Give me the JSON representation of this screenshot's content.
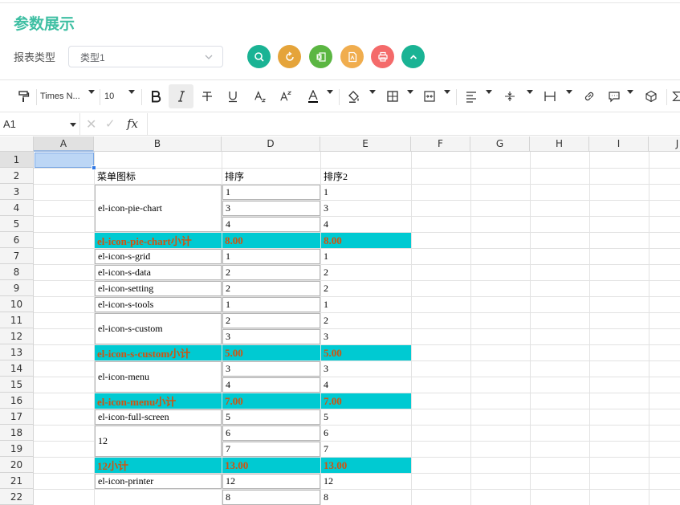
{
  "page": {
    "title": "参数展示"
  },
  "filter": {
    "label": "报表类型",
    "value": "类型1"
  },
  "actions": [
    {
      "name": "search",
      "color": "#1ab394"
    },
    {
      "name": "reset",
      "color": "#e5a43a"
    },
    {
      "name": "excel",
      "color": "#5bb642"
    },
    {
      "name": "pdf",
      "color": "#f0ad4e"
    },
    {
      "name": "print",
      "color": "#f46a6a"
    },
    {
      "name": "collapse",
      "color": "#1ab394"
    }
  ],
  "toolbar": {
    "font_name": "Times N...",
    "font_size": "10"
  },
  "formula": {
    "cell_ref": "A1",
    "fx": "fx"
  },
  "columns": [
    "A",
    "B",
    "D",
    "E",
    "F",
    "G",
    "H",
    "I",
    "J"
  ],
  "rows": [
    "1",
    "2",
    "3",
    "4",
    "5",
    "6",
    "7",
    "8",
    "9",
    "10",
    "11",
    "12",
    "13",
    "14",
    "15",
    "16",
    "17",
    "18",
    "19",
    "20",
    "21",
    "22"
  ],
  "cells": {
    "b2": "菜单图标",
    "d2": "排序",
    "e2": "排序2",
    "b3": "el-icon-pie-chart",
    "d3": "1",
    "e3": "1",
    "d4": "3",
    "e4": "3",
    "d5": "4",
    "e5": "4",
    "b6": "el-icon-pie-chart小计",
    "d6": "8.00",
    "e6": "8.00",
    "b7": "el-icon-s-grid",
    "d7": "1",
    "e7": "1",
    "b8": "el-icon-s-data",
    "d8": "2",
    "e8": "2",
    "b9": "el-icon-setting",
    "d9": "2",
    "e9": "2",
    "b10": "el-icon-s-tools",
    "d10": "1",
    "e10": "1",
    "b11": "el-icon-s-custom",
    "d11": "2",
    "e11": "2",
    "d12": "3",
    "e12": "3",
    "b13": "el-icon-s-custom小计",
    "d13": "5.00",
    "e13": "5.00",
    "b14": "el-icon-menu",
    "d14": "3",
    "e14": "3",
    "d15": "4",
    "e15": "4",
    "b16": "el-icon-menu小计",
    "d16": "7.00",
    "e16": "7.00",
    "b17": "el-icon-full-screen",
    "d17": "5",
    "e17": "5",
    "b18": "12",
    "d18": "6",
    "e18": "6",
    "d19": "7",
    "e19": "7",
    "b20": "12小计",
    "d20": "13.00",
    "e20": "13.00",
    "b21": "el-icon-printer",
    "d21": "12",
    "e21": "12",
    "d22": "8",
    "e22": "8"
  }
}
